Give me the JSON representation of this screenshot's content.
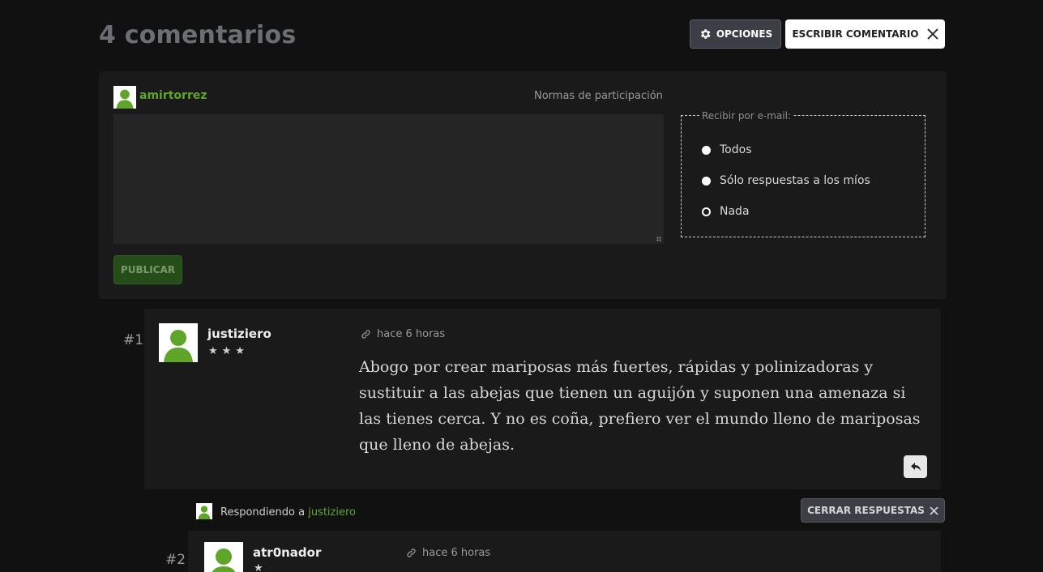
{
  "header": {
    "title": "4 comentarios",
    "options_label": "OPCIONES",
    "write_label": "ESCRIBIR COMENTARIO"
  },
  "editor": {
    "username": "amirtorrez",
    "rules_link": "Normas de participación",
    "textarea_value": "",
    "publish_label": "PUBLICAR",
    "email": {
      "legend": "Recibir por e-mail:",
      "options": [
        {
          "label": "Todos",
          "selected": false
        },
        {
          "label": "Sólo respuestas a los míos",
          "selected": false
        },
        {
          "label": "Nada",
          "selected": true
        }
      ]
    }
  },
  "comments": [
    {
      "number": "#1",
      "user": "justiziero",
      "stars": "★★★",
      "time": "hace 6 horas",
      "body": "Abogo por crear mariposas más fuertes, rápidas y polinizadoras y sustituir a las abejas que tienen un aguijón y suponen una amenaza si las tienes cerca. Y no es coña, prefiero ver el mundo lleno de mariposas que lleno de abejas."
    },
    {
      "number": "#2",
      "user": "atr0nador",
      "stars": "★",
      "time": "hace 6 horas"
    }
  ],
  "replies": {
    "replying_prefix": "Respondiendo a ",
    "replying_to": "justiziero",
    "close_label": "CERRAR RESPUESTAS"
  },
  "colors": {
    "accent_green": "#5fa52a",
    "background": "#111111",
    "panel": "#1a1a1a"
  }
}
